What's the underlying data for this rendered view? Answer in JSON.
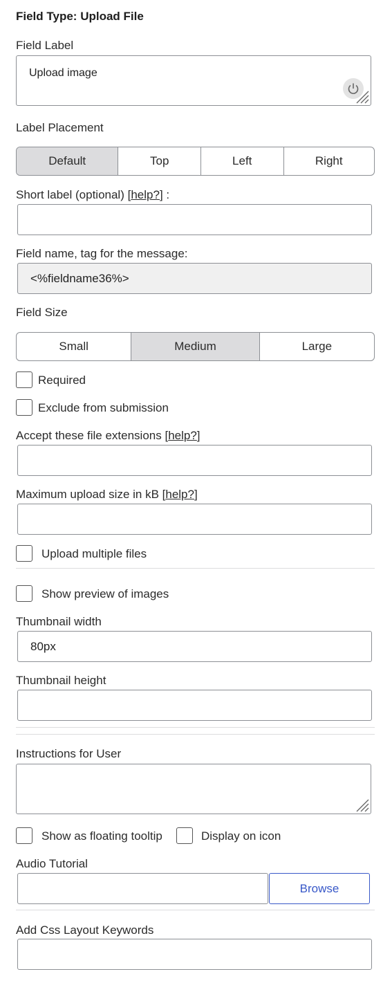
{
  "title": "Field Type: Upload File",
  "field_label": {
    "label": "Field Label",
    "value": "Upload image"
  },
  "label_placement": {
    "label": "Label Placement",
    "options": [
      "Default",
      "Top",
      "Left",
      "Right"
    ],
    "selected": "Default"
  },
  "short_label": {
    "prefix": "Short label (optional) [",
    "help": "help?",
    "suffix": "] :",
    "value": ""
  },
  "field_name": {
    "label": "Field name, tag for the message:",
    "value": "<%fieldname36%>"
  },
  "field_size": {
    "label": "Field Size",
    "options": [
      "Small",
      "Medium",
      "Large"
    ],
    "selected": "Medium"
  },
  "required": {
    "label": "Required",
    "checked": false
  },
  "exclude": {
    "label": "Exclude from submission",
    "checked": false
  },
  "extensions": {
    "prefix": "Accept these file extensions [",
    "help": "help?",
    "suffix": "]",
    "value": ""
  },
  "max_size": {
    "prefix": "Maximum upload size in kB [",
    "help": "help?",
    "suffix": "]",
    "value": ""
  },
  "multiple": {
    "label": "Upload multiple files",
    "checked": false
  },
  "preview": {
    "label": "Show preview of images",
    "checked": false
  },
  "thumb_width": {
    "label": "Thumbnail width",
    "value": "80px"
  },
  "thumb_height": {
    "label": "Thumbnail height",
    "value": ""
  },
  "instructions": {
    "label": "Instructions for User",
    "value": ""
  },
  "tooltip": {
    "label": "Show as floating tooltip",
    "checked": false
  },
  "display_icon": {
    "label": "Display on icon",
    "checked": false
  },
  "audio": {
    "label": "Audio Tutorial",
    "value": "",
    "browse_label": "Browse"
  },
  "css_keywords": {
    "label": "Add Css Layout Keywords",
    "value": ""
  },
  "colors": {
    "accent": "#3858c8",
    "selected_bg": "#dcdcde",
    "readonly_bg": "#f0f0f0",
    "border": "#8c8f94"
  },
  "icons": {
    "resize": "resize-handle-icon",
    "power": "power-icon"
  }
}
